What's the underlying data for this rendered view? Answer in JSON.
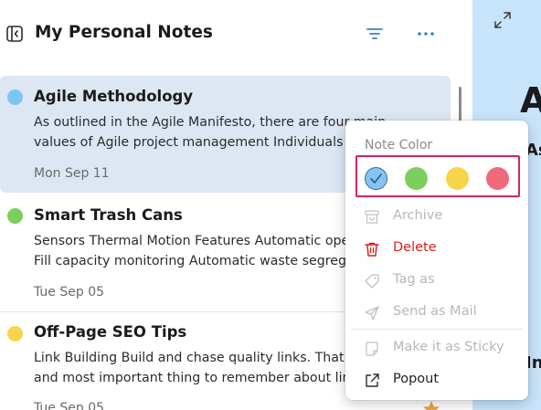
{
  "header": {
    "title": "My Personal Notes",
    "panel_toggle_icon": "sidebar-collapse-icon",
    "filter_icon": "filter-icon",
    "more_icon": "more-horizontal-icon"
  },
  "notes": [
    {
      "title": "Agile Methodology",
      "body_line1": "As outlined in the Agile Manifesto, there are four main",
      "body_line2": "values of Agile project management Individuals",
      "date": "Mon Sep 11",
      "color": "#7cc6f4",
      "selected": true
    },
    {
      "title": "Smart Trash Cans",
      "body_line1": "Sensors Thermal Motion Features Automatic opening",
      "body_line2": "Fill capacity monitoring Automatic waste segregation",
      "date": "Tue Sep 05",
      "color": "#7ccf5c",
      "selected": false
    },
    {
      "title": "Off-Page SEO Tips",
      "body_line1": "Link Building Build and chase quality links. That’s the",
      "body_line2": "and most important thing to remember about links",
      "date": "Tue Sep 05",
      "color": "#f7d54a",
      "selected": false
    }
  ],
  "right_pane": {
    "expand_icon": "expand-icon",
    "heading_fragment": "A",
    "sub_fragment_1": "As",
    "sub_fragment_2": "In"
  },
  "context_menu": {
    "heading": "Note Color",
    "colors": [
      {
        "name": "blue",
        "hex": "#84c4f2",
        "selected": true
      },
      {
        "name": "green",
        "hex": "#7ccf5c",
        "selected": false
      },
      {
        "name": "yellow",
        "hex": "#f7d54a",
        "selected": false
      },
      {
        "name": "red",
        "hex": "#ef6b7b",
        "selected": false
      }
    ],
    "items": {
      "archive": "Archive",
      "delete": "Delete",
      "tag_as": "Tag as",
      "send_as_mail": "Send as Mail",
      "make_sticky": "Make it as Sticky",
      "popout": "Popout"
    }
  }
}
